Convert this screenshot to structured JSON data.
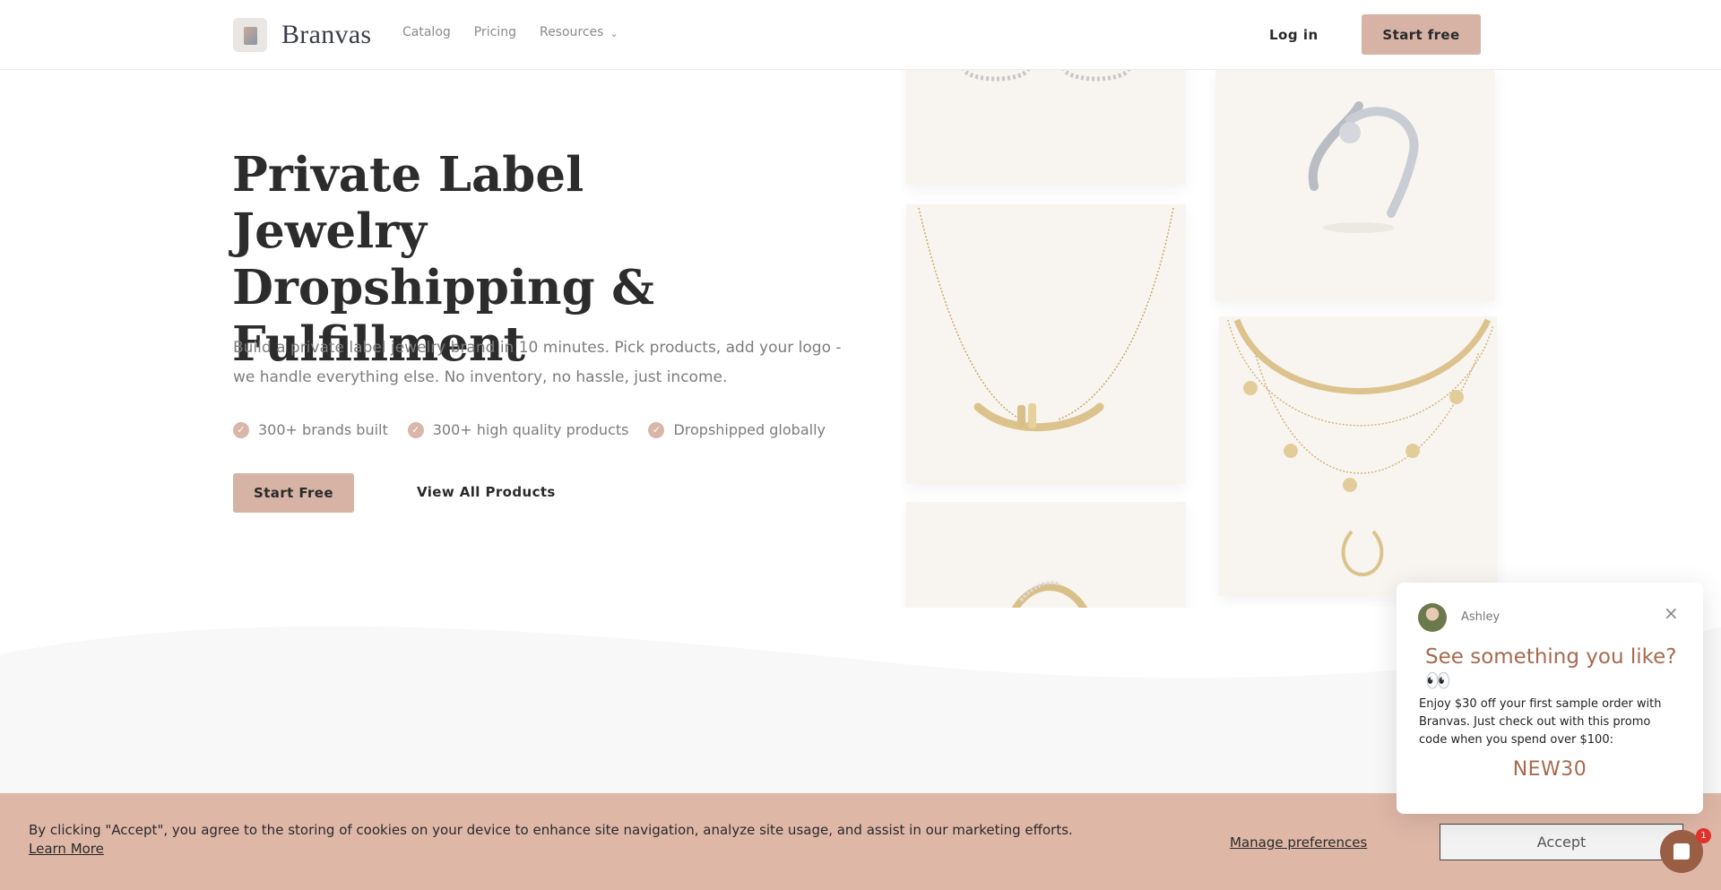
{
  "header": {
    "brand": "Branvas",
    "nav": [
      {
        "label": "Catalog"
      },
      {
        "label": "Pricing"
      },
      {
        "label": "Resources"
      }
    ],
    "login_label": "Log in",
    "start_label": "Start free"
  },
  "hero": {
    "title": "Private Label Jewelry Dropshipping & Fulfillment",
    "subtitle": "Build a private label jewelry brand in 10 minutes. Pick products, add your logo - we handle everything else. No inventory, no hassle, just income.",
    "bullets": [
      "300+ brands built",
      "300+ high quality products",
      "Dropshipped globally"
    ],
    "primary_button": "Start Free",
    "secondary_button": "View All Products"
  },
  "chat_popup": {
    "agent_name": "Ashley",
    "heading": "See something you like? 👀",
    "body": "Enjoy $30 off your first sample order with Branvas. Just check out with this promo code when you spend over $100:",
    "promo_code": "NEW30",
    "close_label": "×"
  },
  "cookie_bar": {
    "text": "By clicking \"Accept\", you agree to the storing of cookies on your device to enhance site navigation, analyze site usage,  and assist in our marketing efforts.",
    "learn_more": "Learn More",
    "manage_label": "Manage preferences",
    "accept_label": "Accept"
  },
  "chat_launcher": {
    "badge_count": "1"
  },
  "colors": {
    "accent": "#d6b3a4",
    "cookie_bg": "#dfb7a7",
    "promo": "#a86a4f",
    "launcher": "#9a5e44"
  }
}
